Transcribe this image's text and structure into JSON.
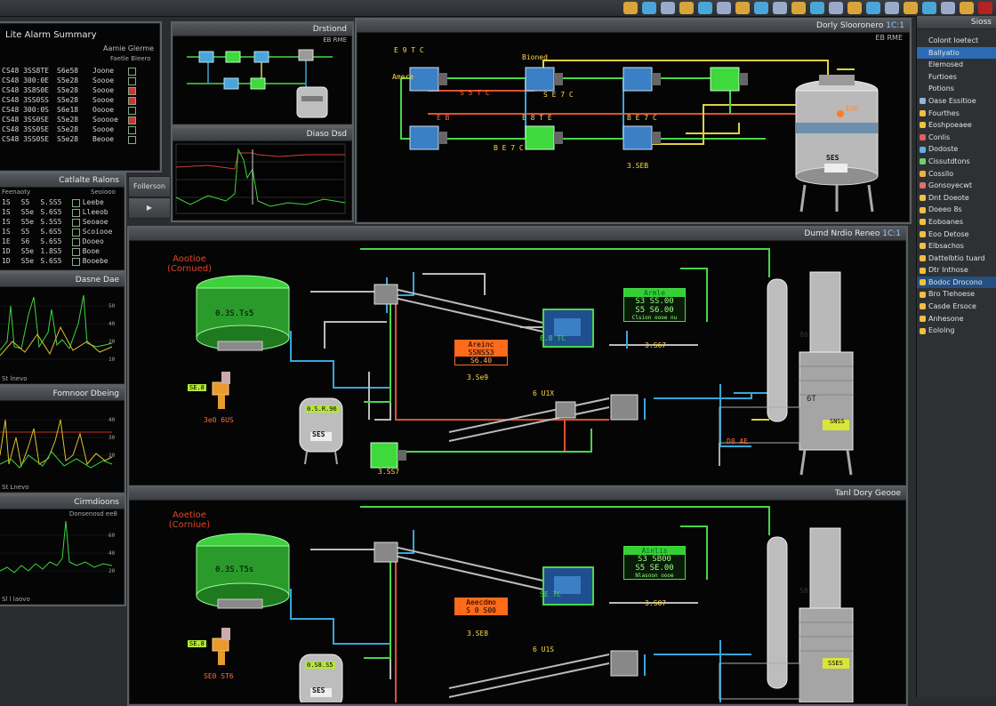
{
  "toolbar": {
    "icons": [
      "tool-icon",
      "gear-icon",
      "refresh-icon",
      "alarm-icon",
      "chart-icon",
      "folder-icon",
      "diamond-icon",
      "leaf-icon",
      "pen-icon",
      "palette-icon",
      "grid-icon",
      "share-icon",
      "bell-icon",
      "bolt-icon",
      "star-icon",
      "pin-icon",
      "shield-icon",
      "person-icon",
      "flag-icon",
      "close-icon"
    ]
  },
  "alarm_panel": {
    "title": "Lite Alarm Summary",
    "subtitle": "Aamie Glerme",
    "col_header": "Faetle Bleero",
    "rows": [
      {
        "code": "CS48 3SS8TE",
        "name": "Joone",
        "value": "S6e58"
      },
      {
        "code": "CS48 300:0E",
        "name": "Soooe",
        "value": "S5e28"
      },
      {
        "code": "CS48 3S8S0E",
        "name": "Soooe",
        "value": "S5e28"
      },
      {
        "code": "CS48 3SS0SS",
        "name": "Soooe",
        "value": "S5e28"
      },
      {
        "code": "CS48 300:0S",
        "name": "Ooooe",
        "value": "S6e18"
      },
      {
        "code": "CS48 3SS0SE",
        "name": "Sooooe",
        "value": "S5e28"
      },
      {
        "code": "CS48 3SS0SE",
        "name": "Soooe",
        "value": "S5e28"
      },
      {
        "code": "CS48 3SS0SE",
        "name": "Beooe",
        "value": "S5e28"
      }
    ]
  },
  "chart_small": {
    "title": "Diaso Dsd"
  },
  "window_pumps": {
    "title": "Dorly Slooronero",
    "subtitle": "EB RME",
    "badge": "1C:1"
  },
  "window_mini": {
    "title": "Drstiond",
    "subtitle": "EB RME"
  },
  "tank_labels": {
    "pump_a": "Amere",
    "pump_a_code": "E 9 T C",
    "pump_b": "Bioned",
    "pump_b_code": "S 5 T C",
    "pump_c": "S E 7 C",
    "pump_d": "E B",
    "pump_d_code": "E 8 T E",
    "pump_e": "B E 7 C",
    "pump_f": "3.SEB",
    "tank_code": "SES",
    "tank_tag": "ERO"
  },
  "side_buttons": {
    "btn1": "Follerson",
    "btn2": "▶"
  },
  "catalyst_panel": {
    "title": "Catlalte Ralons",
    "header": "Feenaoty",
    "sub": "Seoiooo",
    "rows": [
      {
        "a": "1S",
        "b": "S5",
        "c": "S.SS5",
        "d": "Leebe"
      },
      {
        "a": "1S",
        "b": "S5e",
        "c": "S.6S5",
        "d": "Lleeob"
      },
      {
        "a": "1S",
        "b": "S5e",
        "c": "S.5S5",
        "d": "Seoaoe"
      },
      {
        "a": "1S",
        "b": "S5",
        "c": "S.6S5",
        "d": "Scoiooe"
      },
      {
        "a": "1E",
        "b": "S6",
        "c": "S.6S5",
        "d": "Dooeo"
      },
      {
        "a": "1D",
        "b": "S5e",
        "c": "1.8S5",
        "d": "Booe"
      },
      {
        "a": "1D",
        "b": "S5e",
        "c": "S.6S5",
        "d": "Booebe"
      }
    ]
  },
  "trend_panels": [
    {
      "title": "Dasne Dae",
      "footer": "St lnevo"
    },
    {
      "title": "Fomnoor Dbeing",
      "footer": "St Lnevo"
    },
    {
      "title": "Cirmdioons",
      "sub": "Donsenosd ee8",
      "footer": "Sl l laovo"
    }
  ],
  "process_windows": [
    {
      "title": "Dumd Nrdio Reneo",
      "badge": "1C:1",
      "red_title_1": "Aootioe",
      "red_title_2": "(Cornued)",
      "tank_value": "0.3S.Ts5",
      "valve_tag": "SE.8",
      "valve_code": "3e0 6US",
      "vessel_value": "0.S.R.96",
      "vessel_tag": "SES",
      "motor_code": "3.SS7",
      "orange_title": "Areinc",
      "orange_l1": "SSNSS3",
      "orange_l2": "S6.40",
      "orange_code": "3.Se9",
      "green_title": "Armle",
      "green_l1": "S3 SS.00",
      "green_l2": "S5 S6.00",
      "green_l3": "Clsion oooe nu",
      "green_code": "3.S67",
      "blue_code": "E.8 TC",
      "screw_code": "6 U1X",
      "column_tag": "SNSS",
      "column_code": "6T",
      "column_label": "D8 AE",
      "small_tag": "80"
    },
    {
      "title": "Tanl Dory Geooe",
      "badge": "",
      "red_title_1": "Aoetioe",
      "red_title_2": "(Corniue)",
      "tank_value": "0.3S.T5s",
      "valve_tag": "SE.8",
      "valve_code": "SE0 ST6",
      "vessel_value": "0.S8.S5",
      "vessel_tag": "SES",
      "motor_code": "",
      "orange_title": "Aeecdmo",
      "orange_l1": "S 0 S00",
      "orange_l2": "",
      "orange_code": "3.SE8",
      "green_title": "Ainlis",
      "green_l1": "S3 SB00",
      "green_l2": "S5 SE.00",
      "green_l3": "Nlasoon oooe",
      "green_code": "3.S07",
      "blue_code": "SE TC",
      "screw_code": "6 U1S",
      "column_tag": "SSES",
      "column_code": "",
      "column_label": "",
      "small_tag": "58"
    }
  ],
  "sidebar": {
    "title": "Sioss",
    "items": [
      {
        "label": "Colont Ioetect",
        "icon": "",
        "sel": false
      },
      {
        "label": "Ballyatio",
        "icon": "",
        "sel": true
      },
      {
        "label": "Elemosed",
        "icon": "",
        "sel": false
      },
      {
        "label": "Furtioes",
        "icon": "",
        "sel": false
      },
      {
        "label": "Potions",
        "icon": "",
        "sel": false
      },
      {
        "label": "Oase Essitioe",
        "icon": "doc-icon",
        "sel": false
      },
      {
        "label": "Fourthes",
        "icon": "gear-icon",
        "sel": false
      },
      {
        "label": "Eoshpoeaee",
        "icon": "gear-icon",
        "sel": false
      },
      {
        "label": "Conlis",
        "icon": "heart-icon",
        "sel": false
      },
      {
        "label": "Dodoste",
        "icon": "shield-icon",
        "sel": false
      },
      {
        "label": "Cissutdtons",
        "icon": "grid-icon",
        "sel": false
      },
      {
        "label": "Cossllo",
        "icon": "star-icon",
        "sel": false
      },
      {
        "label": "Gonsoyecwt",
        "icon": "dot-icon",
        "sel": false
      },
      {
        "label": "Dnt Doeote",
        "icon": "gear-icon",
        "sel": false
      },
      {
        "label": "Doeeo 8s",
        "icon": "gear-icon",
        "sel": false
      },
      {
        "label": "Eoboanes",
        "icon": "gear-icon",
        "sel": false
      },
      {
        "label": "Eoo Detose",
        "icon": "gear-icon",
        "sel": false
      },
      {
        "label": "Elbsachos",
        "icon": "gear-icon",
        "sel": false
      },
      {
        "label": "Dattelbtio tuard",
        "icon": "gear-icon",
        "sel": false
      },
      {
        "label": "Dtr Inthose",
        "icon": "gear-icon",
        "sel": false
      },
      {
        "label": "Bodoc Drocono",
        "icon": "gear-icon",
        "sel": true
      },
      {
        "label": "Bro Tlehoese",
        "icon": "gear-icon",
        "sel": false
      },
      {
        "label": "Casde Ersoce",
        "icon": "gear-icon",
        "sel": false
      },
      {
        "label": "Anhesone",
        "icon": "gear-icon",
        "sel": false
      },
      {
        "label": "Eololng",
        "icon": "gear-icon",
        "sel": false
      }
    ]
  }
}
